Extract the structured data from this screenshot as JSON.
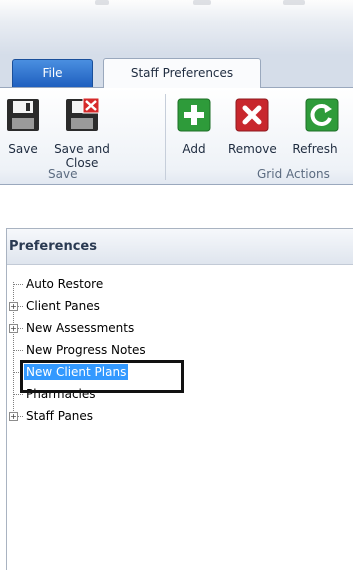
{
  "tabs": {
    "file_label": "File",
    "active_label": "Staff Preferences"
  },
  "ribbon": {
    "save_group": {
      "label": "Save",
      "buttons": [
        {
          "label_line1": "Save",
          "label_line2": "",
          "icon": "floppy-disk-icon"
        },
        {
          "label_line1": "Save and",
          "label_line2": "Close",
          "icon": "floppy-disk-close-icon"
        }
      ]
    },
    "grid_group": {
      "label": "Grid Actions",
      "buttons": [
        {
          "label": "Add",
          "icon": "plus-icon",
          "color": "#2e9b3a"
        },
        {
          "label": "Remove",
          "icon": "x-icon",
          "color": "#c8272d"
        },
        {
          "label": "Refresh",
          "icon": "refresh-icon",
          "color": "#2e9b3a"
        }
      ]
    }
  },
  "preferences": {
    "header": "Preferences",
    "items": [
      {
        "label": "Auto Restore",
        "expandable": false
      },
      {
        "label": "Client Panes",
        "expandable": true
      },
      {
        "label": "New Assessments",
        "expandable": true
      },
      {
        "label": "New Progress Notes",
        "expandable": false
      },
      {
        "label": "New Client Plans",
        "expandable": false,
        "selected": true
      },
      {
        "label": "Pharmacies",
        "expandable": false
      },
      {
        "label": "Staff Panes",
        "expandable": true
      }
    ]
  },
  "colors": {
    "selection": "#3399ff",
    "file_tab": "#2a6fd0"
  }
}
